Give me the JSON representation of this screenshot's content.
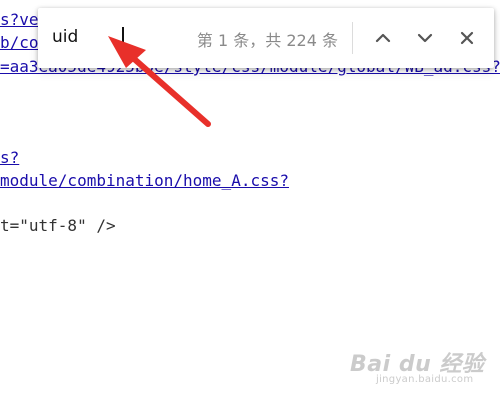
{
  "source_lines": [
    "s?ve",
    "b/co",
    "=aa3ea05de4925b0e/style/css/module/global/WB_ad.css?",
    "s?",
    "module/combination/home_A.css?",
    "t=\"utf-8\" />"
  ],
  "find_bar": {
    "query": "uid",
    "match_count": "第 1 条，共 224 条",
    "prev_icon": "chevron-up-icon",
    "next_icon": "chevron-down-icon",
    "close_icon": "close-icon"
  },
  "annotation": {
    "arrow_color": "#e8302a"
  },
  "watermark": {
    "logo": "Bai du 经验",
    "subtitle": "jingyan.baidu.com"
  }
}
